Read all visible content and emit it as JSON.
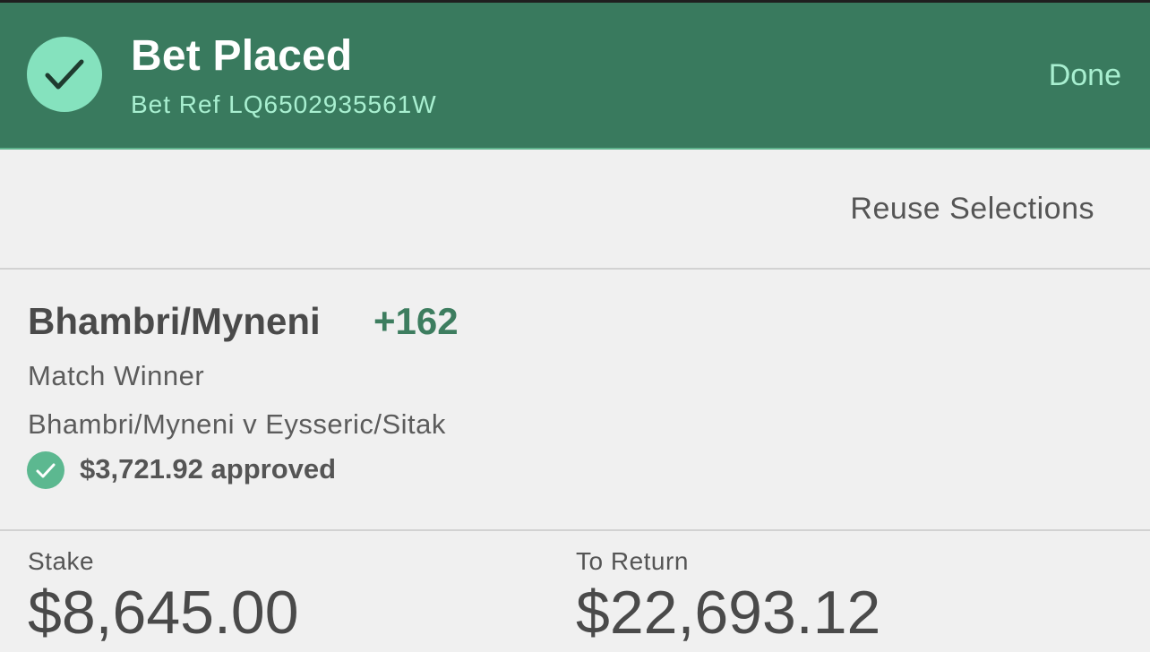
{
  "header": {
    "title": "Bet Placed",
    "bet_ref": "Bet Ref LQ6502935561W",
    "done_label": "Done",
    "status_icon": "checkmark-icon",
    "accent_color": "#397a5e"
  },
  "actions": {
    "reuse_label": "Reuse Selections"
  },
  "selection": {
    "name": "Bhambri/Myneni",
    "odds": "+162",
    "market": "Match Winner",
    "event": "Bhambri/Myneni v Eysseric/Sitak",
    "approved_text": "$3,721.92 approved",
    "approved_icon": "checkmark-icon"
  },
  "totals": {
    "stake_label": "Stake",
    "stake_value": "$8,645.00",
    "return_label": "To Return",
    "return_value": "$22,693.12"
  }
}
